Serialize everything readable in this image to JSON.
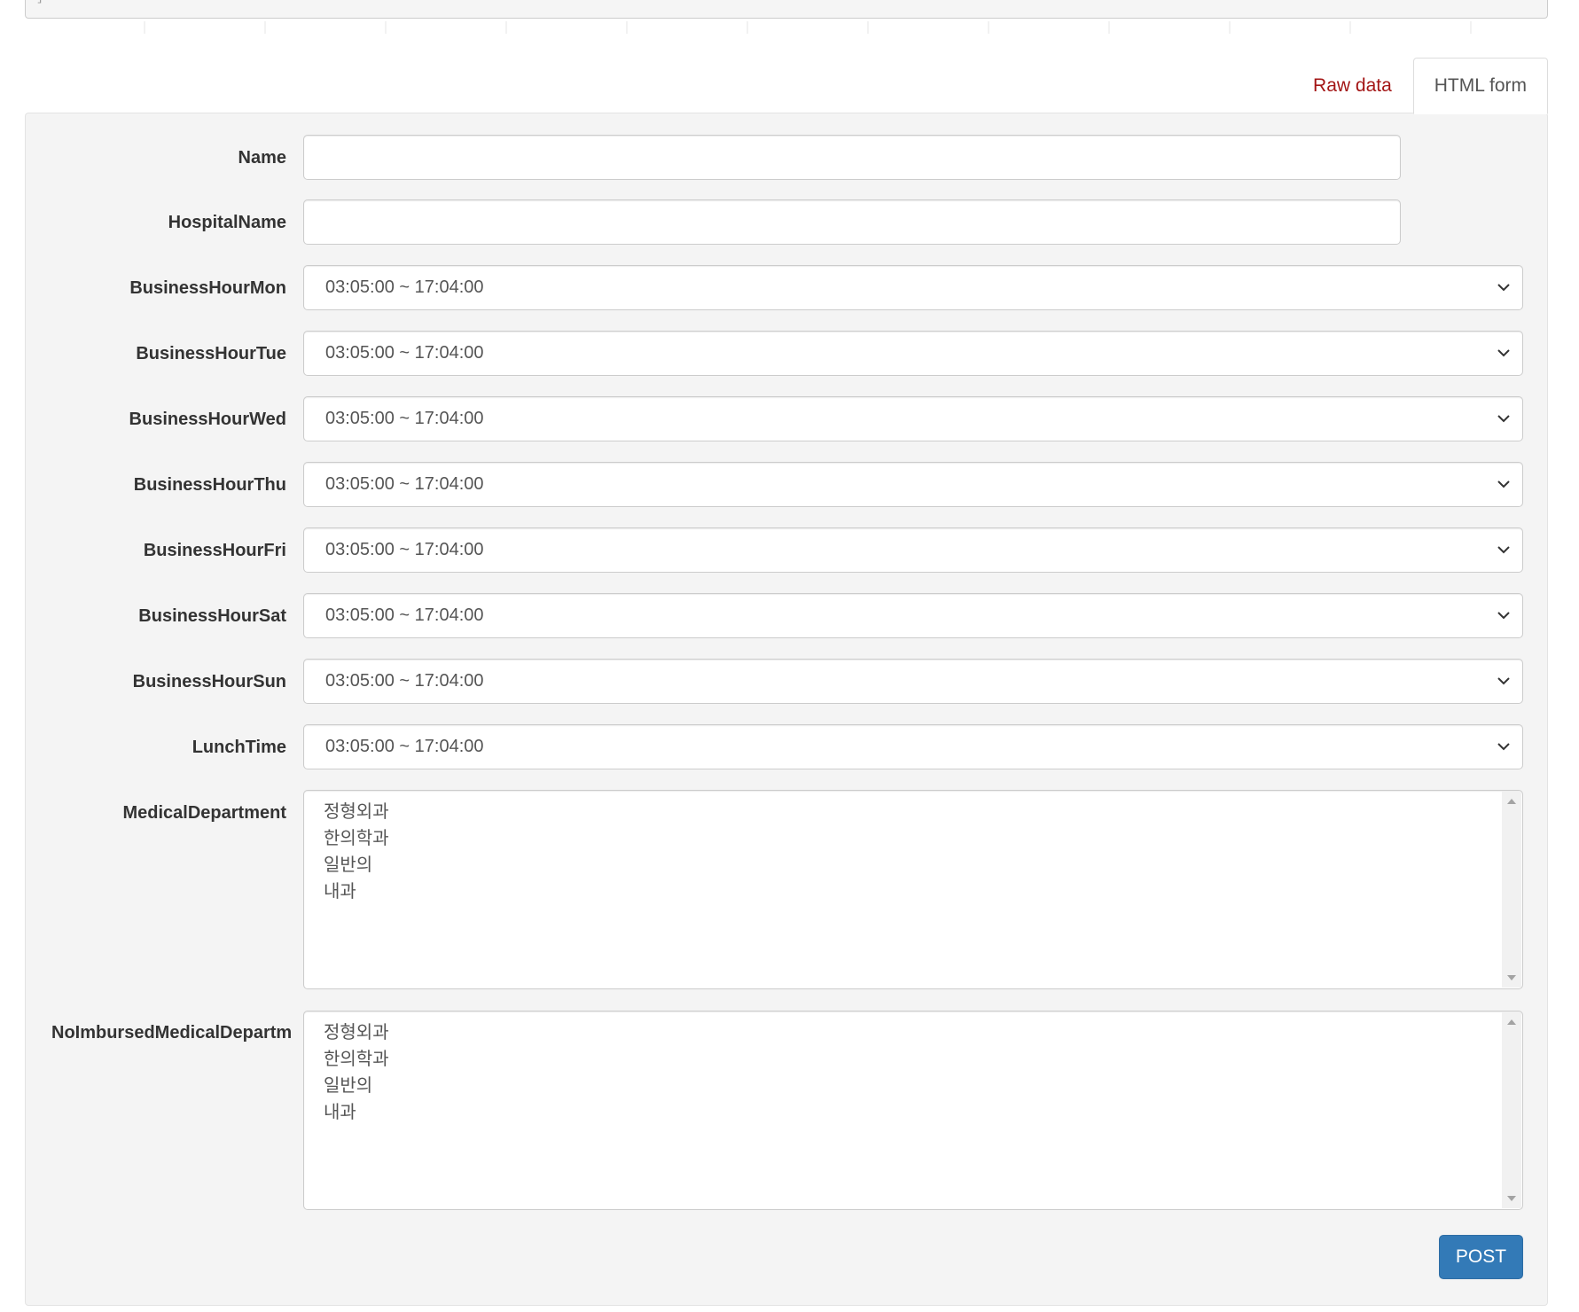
{
  "tabs": {
    "raw_label": "Raw data",
    "html_label": "HTML form"
  },
  "form": {
    "name_label": "Name",
    "name_value": "",
    "hospital_label": "HospitalName",
    "hospital_value": "",
    "mon_label": "BusinessHourMon",
    "mon_value": "03:05:00 ~ 17:04:00",
    "tue_label": "BusinessHourTue",
    "tue_value": "03:05:00 ~ 17:04:00",
    "wed_label": "BusinessHourWed",
    "wed_value": "03:05:00 ~ 17:04:00",
    "thu_label": "BusinessHourThu",
    "thu_value": "03:05:00 ~ 17:04:00",
    "fri_label": "BusinessHourFri",
    "fri_value": "03:05:00 ~ 17:04:00",
    "sat_label": "BusinessHourSat",
    "sat_value": "03:05:00 ~ 17:04:00",
    "sun_label": "BusinessHourSun",
    "sun_value": "03:05:00 ~ 17:04:00",
    "lunch_label": "LunchTime",
    "lunch_value": "03:05:00 ~ 17:04:00",
    "medical_label": "MedicalDepartment",
    "medical_lines": [
      "정형외과",
      "한의학과",
      "일반의",
      "내과"
    ],
    "noimbursed_label": "NoImbursedMedicalDepartm",
    "noimbursed_lines": [
      "정형외과",
      "한의학과",
      "일반의",
      "내과"
    ],
    "post_label": "POST"
  },
  "icons": {
    "select_arrow": "chevron-down-icon",
    "scroll_up": "scroll-up-arrow-icon",
    "scroll_down": "scroll-down-arrow-icon"
  }
}
